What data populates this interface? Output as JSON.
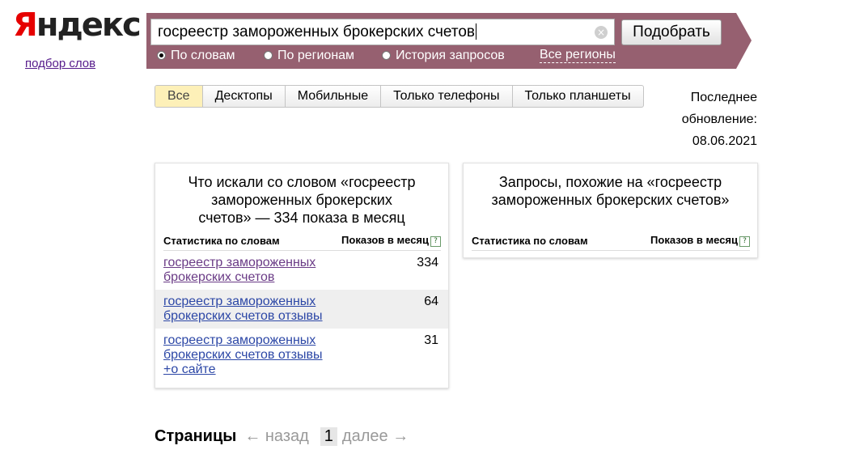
{
  "logo": {
    "first": "Я",
    "rest": "ндекс"
  },
  "subtitle": "подбор слов",
  "search": {
    "value": "госреестр замороженных брокерских счетов",
    "clear_glyph": "×",
    "submit_label": "Подобрать"
  },
  "modes": [
    {
      "label": "По словам",
      "selected": true
    },
    {
      "label": "По регионам",
      "selected": false
    },
    {
      "label": "История запросов",
      "selected": false
    }
  ],
  "all_regions": "Все регионы",
  "device_tabs": [
    "Все",
    "Десктопы",
    "Мобильные",
    "Только телефоны",
    "Только планшеты"
  ],
  "active_tab": "Все",
  "updated": {
    "line1": "Последнее",
    "line2": "обновление:",
    "date": "08.06.2021"
  },
  "left_panel": {
    "title": "Что искали со словом «госреестр замороженных брокерских счетов» — 334 показа в месяц",
    "col_words": "Статистика по словам",
    "col_shows": "Показов в месяц",
    "help_glyph": "?",
    "rows": [
      {
        "phrase": "госреестр замороженных брокерских счетов",
        "count": "334"
      },
      {
        "phrase": "госреестр замороженных брокерских счетов отзывы",
        "count": "64"
      },
      {
        "phrase": "госреестр замороженных брокерских счетов отзывы +о сайте",
        "count": "31"
      }
    ]
  },
  "right_panel": {
    "title": "Запросы, похожие на «госреестр замороженных брокерских счетов»",
    "col_words": "Статистика по словам",
    "col_shows": "Показов в месяц",
    "help_glyph": "?"
  },
  "pager": {
    "label": "Страницы",
    "prev": "← назад",
    "current": "1",
    "next": "далее →"
  },
  "colors": {
    "bar": "#966070",
    "logo_red": "#e60000",
    "active_tab": "#fdf0b8"
  }
}
